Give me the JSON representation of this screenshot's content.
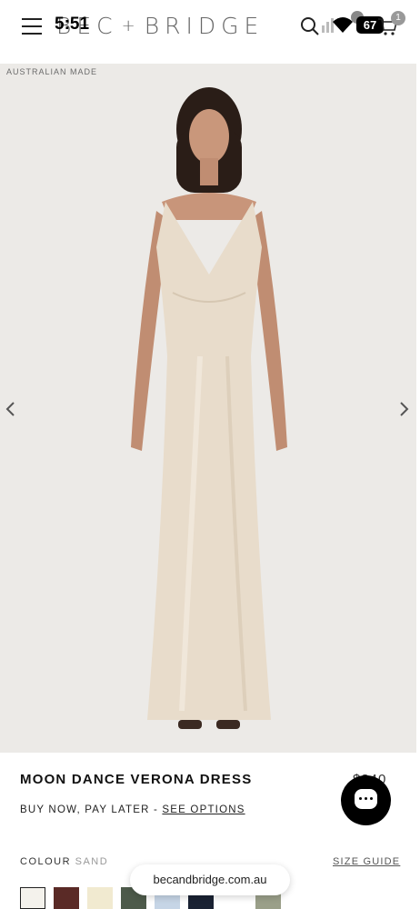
{
  "status_bar": {
    "time": "5:51",
    "battery": "67",
    "cart_count": "1"
  },
  "header": {
    "brand_left": "BEC",
    "brand_plus": "+",
    "brand_right": "BRIDGE"
  },
  "gallery": {
    "badge": "AUSTRALIAN MADE"
  },
  "product": {
    "title": "MOON DANCE VERONA DRESS",
    "price": "$340",
    "bnpl_text": "BUY NOW, PAY LATER - ",
    "bnpl_link": "SEE OPTIONS",
    "colour_label": "COLOUR",
    "colour_value": "SAND",
    "size_guide": "SIZE GUIDE"
  },
  "browser": {
    "url": "becandbridge.com.au"
  },
  "swatches": [
    {
      "name": "white",
      "color": "#f4f2ec"
    },
    {
      "name": "chocolate",
      "color": "#5a2a26"
    },
    {
      "name": "cream",
      "color": "#f1ead0"
    },
    {
      "name": "olive",
      "color": "#4d5a4a"
    },
    {
      "name": "pale-blue",
      "color": "#c6d5e6"
    },
    {
      "name": "navy",
      "color": "#1a2233"
    },
    {
      "name": "sage",
      "color": "#9a9f89"
    }
  ],
  "colors": {
    "gallery_bg": "#eceae7",
    "dress": "#e8dccb"
  }
}
